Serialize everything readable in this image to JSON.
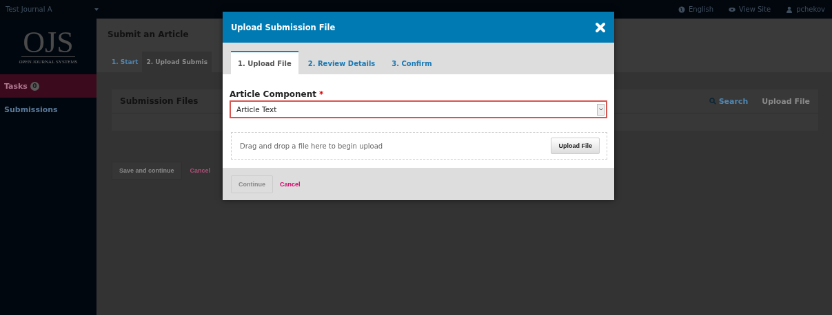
{
  "top_bar": {
    "journal": "Test Journal A",
    "links": [
      {
        "kind": "globe",
        "label": "English"
      },
      {
        "kind": "eye",
        "label": "View Site"
      },
      {
        "kind": "user",
        "label": "pchekov"
      }
    ]
  },
  "sidebar": {
    "logo": "OJS",
    "logo_caption": "OPEN JOURNAL SYSTEMS",
    "items": [
      {
        "label": "Tasks",
        "badge": "0",
        "selected": true
      },
      {
        "label": "Submissions",
        "selected": false
      }
    ]
  },
  "page": {
    "title": "Submit an Article",
    "tabs": [
      {
        "label": "1. Start",
        "selected": false
      },
      {
        "label": "2. Upload Submis",
        "selected": true
      }
    ],
    "files_panel": {
      "title": "Submission Files",
      "actions": [
        {
          "kind": "search",
          "label": "Search"
        },
        {
          "kind": "plain",
          "label": "Upload File"
        }
      ]
    },
    "buttons": [
      {
        "kind": "primary",
        "label": "Save and continue"
      },
      {
        "kind": "cancel",
        "label": "Cancel"
      }
    ]
  },
  "modal": {
    "title": "Upload Submission File",
    "tabs": [
      {
        "label": "1. Upload File",
        "selected": true
      },
      {
        "label": "2. Review Details",
        "selected": false
      },
      {
        "label": "3. Confirm",
        "selected": false
      }
    ],
    "field_label": "Article Component",
    "required_mark": "*",
    "select_value": "Article Text",
    "invalid": true,
    "dropzone_text": "Drag and drop a file here to begin upload",
    "upload_button": "Upload File",
    "footer_buttons": [
      {
        "kind": "continue",
        "label": "Continue",
        "disabled": true
      },
      {
        "kind": "cancel",
        "label": "Cancel"
      }
    ]
  }
}
